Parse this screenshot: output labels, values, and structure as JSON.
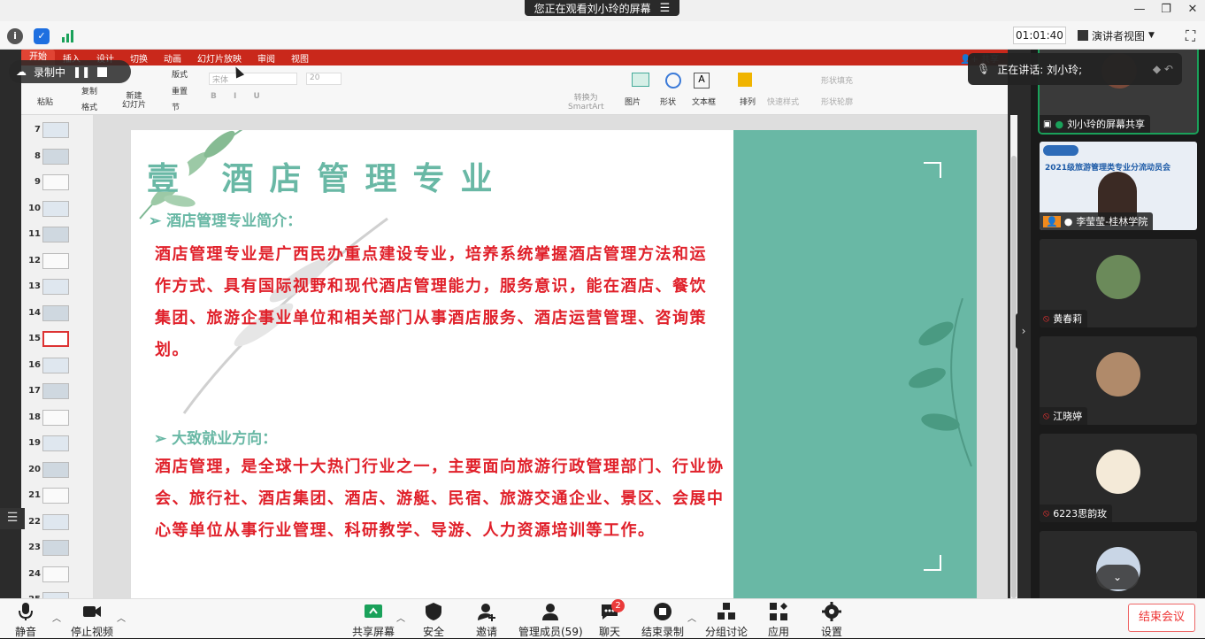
{
  "window": {
    "share_banner": "您正在观看刘小玲的屏幕"
  },
  "topbar": {
    "timer": "01:01:40",
    "view_mode": "演讲者视图"
  },
  "ppt": {
    "tabs": [
      "开始",
      "插入",
      "设计",
      "切换",
      "动画",
      "幻灯片放映",
      "审阅",
      "视图"
    ],
    "share_btn": "共享",
    "ribbon": {
      "paste": "粘贴",
      "copy": "复制",
      "format": "格式",
      "new_slide": "新建\n幻灯片",
      "layout": "版式",
      "reset": "重置",
      "section": "节",
      "font": "宋体",
      "size": "20",
      "smartart": "转换为\nSmartArt",
      "picture": "图片",
      "shape": "形状",
      "textbox": "文本框",
      "arrange": "排列",
      "quick_style": "快速样式",
      "fill": "形状填充",
      "outline": "形状轮廓"
    },
    "slide_numbers": [
      "7",
      "8",
      "9",
      "10",
      "11",
      "12",
      "13",
      "14",
      "15",
      "16",
      "17",
      "18",
      "19",
      "20",
      "21",
      "22",
      "23",
      "24",
      "25"
    ],
    "selected_slide": "15"
  },
  "recording": {
    "label": "录制中"
  },
  "slide": {
    "heading": "壹  酒店管理专业",
    "section1_title": "➢ 酒店管理专业简介：",
    "section1_body": "酒店管理专业是广西民办重点建设专业，培养系统掌握酒店管理方法和运作方式、具有国际视野和现代酒店管理能力，服务意识，能在酒店、餐饮集团、旅游企事业单位和相关部门从事酒店服务、酒店运营管理、咨询策划。",
    "section2_title": "➢ 大致就业方向：",
    "section2_body": "酒店管理，是全球十大热门行业之一，主要面向旅游行政管理部门、行业协会、旅行社、酒店集团、酒店、游艇、民宿、旅游交通企业、景区、会展中心等单位从事行业管理、科研教学、导游、人力资源培训等工作。"
  },
  "speaker": {
    "label": "正在讲话: 刘小玲;"
  },
  "participants": [
    {
      "name": "刘小玲的屏幕共享",
      "active": true
    },
    {
      "name": "李莹莹-桂林学院",
      "active": false,
      "video_caption": "2021级旅游管理类专业分流动员会"
    },
    {
      "name": "黄春莉",
      "active": false
    },
    {
      "name": "江晓婷",
      "active": false
    },
    {
      "name": "6223思韵玫",
      "active": false
    },
    {
      "name": "",
      "active": false
    }
  ],
  "toolbar": {
    "mute": "静音",
    "stop_video": "停止视频",
    "share_screen": "共享屏幕",
    "security": "安全",
    "invite": "邀请",
    "manage_members": "管理成员(59)",
    "chat": "聊天",
    "chat_badge": "2",
    "end_recording": "结束录制",
    "breakout": "分组讨论",
    "apps": "应用",
    "settings": "设置",
    "end_meeting": "结束会议"
  },
  "colors": {
    "teal": "#69b8a5",
    "slide_red": "#e0202a",
    "ppt_red": "#c9281b",
    "active_green": "#1aa15a"
  }
}
